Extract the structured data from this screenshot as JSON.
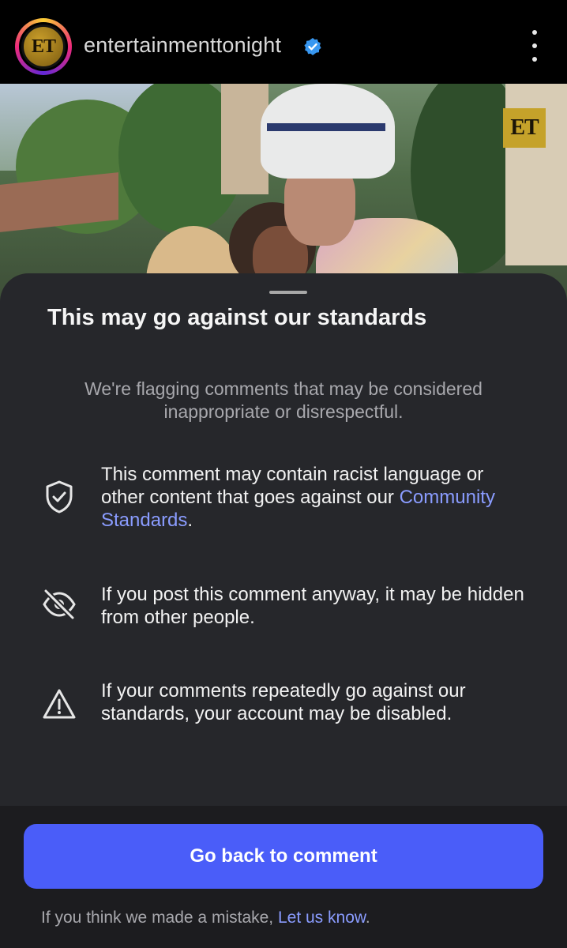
{
  "header": {
    "avatar_initials": "ET",
    "username": "entertainmenttonight",
    "verified_icon": "verified-badge-icon",
    "more_icon": "more-vertical-icon"
  },
  "photo": {
    "watermark": "ET"
  },
  "sheet": {
    "title": "This may go against our standards",
    "subtitle": "We're flagging comments that may be considered inappropriate or disrespectful.",
    "items": [
      {
        "icon": "shield-check-icon",
        "text_before": "This comment may contain racist language or other content that goes against our ",
        "link": "Community Standards",
        "text_after": "."
      },
      {
        "icon": "eye-off-icon",
        "text": "If you post this comment anyway, it may be hidden from other people."
      },
      {
        "icon": "warning-triangle-icon",
        "text": "If your comments repeatedly go against our standards, your account may be disabled."
      }
    ]
  },
  "footer": {
    "primary_button": "Go back to comment",
    "note_text": "If you think we made a mistake, ",
    "note_link": "Let us know",
    "note_end": "."
  },
  "colors": {
    "accent": "#4a5df9",
    "link": "#8a9cff",
    "sheet_bg": "#26272b",
    "verified": "#3897f0"
  }
}
